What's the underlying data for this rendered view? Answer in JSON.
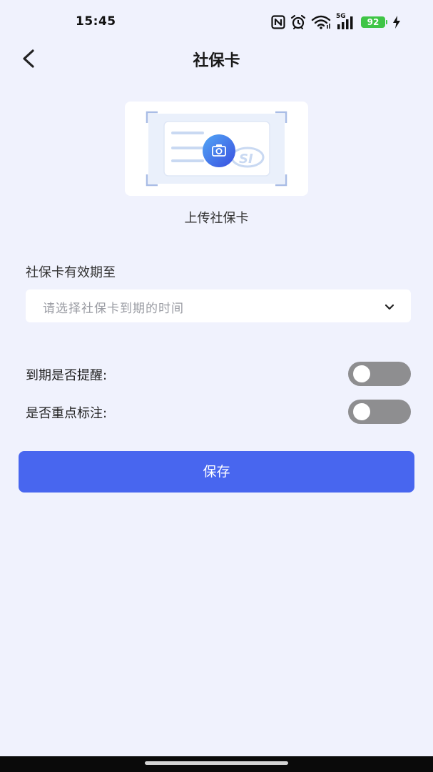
{
  "status_bar": {
    "time": "15:45",
    "network": "5G",
    "battery": "92"
  },
  "nav": {
    "title": "社保卡"
  },
  "upload": {
    "label": "上传社保卡"
  },
  "expiry": {
    "label": "社保卡有效期至",
    "placeholder": "请选择社保卡到期的时间"
  },
  "toggles": [
    {
      "label": "到期是否提醒:",
      "on": false
    },
    {
      "label": "是否重点标注:",
      "on": false
    }
  ],
  "actions": {
    "save_label": "保存"
  },
  "colors": {
    "background": "#f0f2fd",
    "primary": "#4866ef",
    "toggle_off": "#8e8e90",
    "battery": "#3fc546"
  }
}
